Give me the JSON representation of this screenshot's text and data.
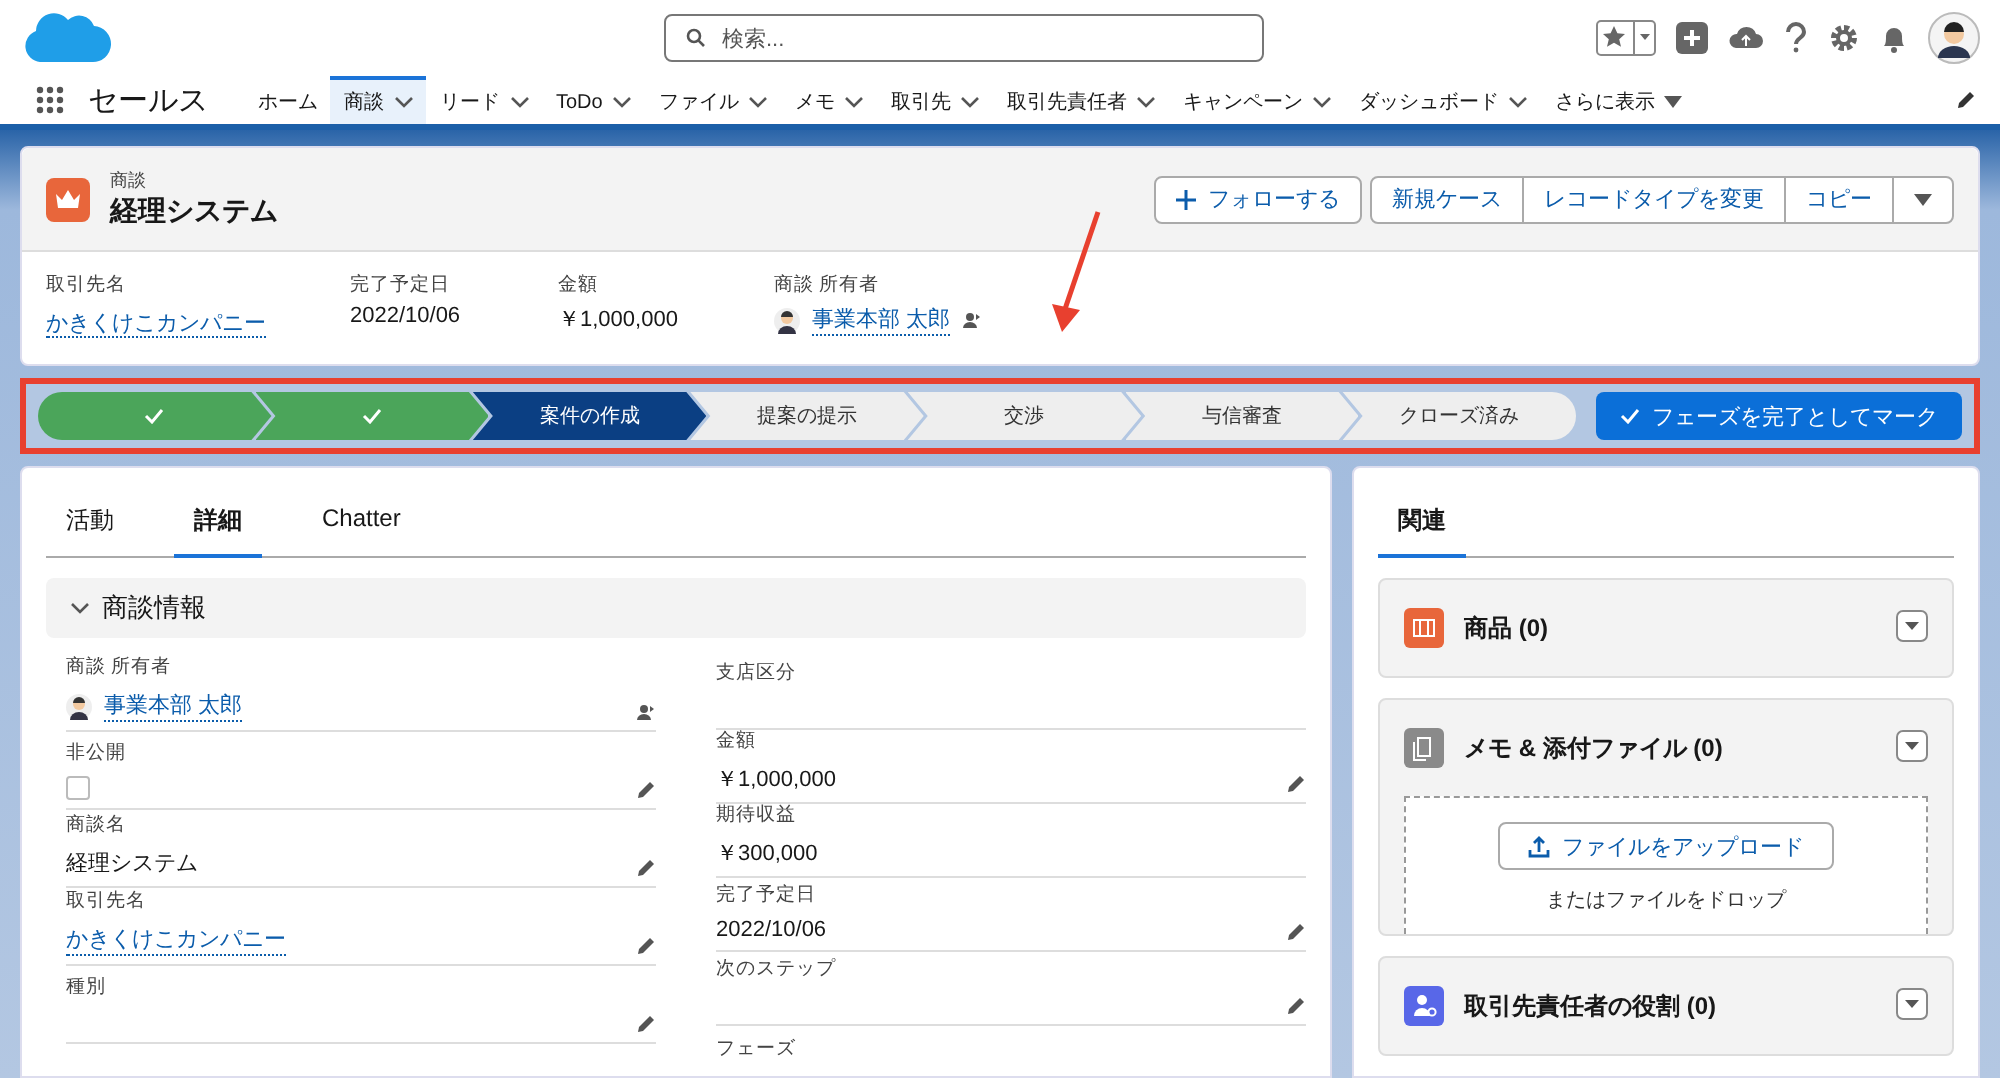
{
  "header": {
    "search": {
      "placeholder": "検索..."
    }
  },
  "nav": {
    "app_name": "セールス",
    "items": [
      {
        "label": "ホーム",
        "kind": "link",
        "selected": false
      },
      {
        "label": "商談",
        "kind": "menu",
        "selected": true
      },
      {
        "label": "リード",
        "kind": "menu",
        "selected": false
      },
      {
        "label": "ToDo",
        "kind": "menu",
        "selected": false
      },
      {
        "label": "ファイル",
        "kind": "menu",
        "selected": false
      },
      {
        "label": "メモ",
        "kind": "menu",
        "selected": false
      },
      {
        "label": "取引先",
        "kind": "menu",
        "selected": false
      },
      {
        "label": "取引先責任者",
        "kind": "menu",
        "selected": false
      },
      {
        "label": "キャンペーン",
        "kind": "menu",
        "selected": false
      },
      {
        "label": "ダッシュボード",
        "kind": "menu",
        "selected": false
      },
      {
        "label": "さらに表示",
        "kind": "more",
        "selected": false
      }
    ]
  },
  "record": {
    "object_label": "商談",
    "title": "経理システム",
    "follow_button": "フォローする",
    "actions": [
      "新規ケース",
      "レコードタイプを変更",
      "コピー"
    ],
    "highlights": [
      {
        "label": "取引先名",
        "value": "かきくけこカンパニー",
        "kind": "link"
      },
      {
        "label": "完了予定日",
        "value": "2022/10/06",
        "kind": "text"
      },
      {
        "label": "金額",
        "value": "￥1,000,000",
        "kind": "text"
      },
      {
        "label": "商談 所有者",
        "value": "事業本部 太郎",
        "kind": "owner"
      }
    ]
  },
  "path": {
    "stages": [
      {
        "completed": true,
        "selected": false
      },
      {
        "completed": true,
        "selected": false
      },
      {
        "label": "案件の作成",
        "completed": false,
        "selected": true
      },
      {
        "label": "提案の提示",
        "completed": false,
        "selected": false
      },
      {
        "label": "交渉",
        "completed": false,
        "selected": false
      },
      {
        "label": "与信審査",
        "completed": false,
        "selected": false
      },
      {
        "label": "クローズ済み",
        "completed": false,
        "selected": false
      }
    ],
    "mark_button": "フェーズを完了としてマーク"
  },
  "detail": {
    "tabs": [
      {
        "label": "活動",
        "selected": false
      },
      {
        "label": "詳細",
        "selected": true
      },
      {
        "label": "Chatter",
        "selected": false
      }
    ],
    "section": {
      "title": "商談情報",
      "expanded": true
    },
    "left_fields": [
      {
        "label": "商談 所有者",
        "kind": "owner",
        "value": "事業本部 太郎",
        "editable": false
      },
      {
        "label": "非公開",
        "kind": "checkbox",
        "checked": false,
        "editable": true
      },
      {
        "label": "商談名",
        "kind": "text",
        "value": "経理システム",
        "editable": true
      },
      {
        "label": "取引先名",
        "kind": "link",
        "value": "かきくけこカンパニー",
        "editable": true
      },
      {
        "label": "種別",
        "kind": "empty",
        "editable": true
      }
    ],
    "right_fields": [
      {
        "label": "支店区分",
        "kind": "empty",
        "editable": false
      },
      {
        "label": "金額",
        "kind": "text",
        "value": "￥1,000,000",
        "editable": true
      },
      {
        "label": "期待収益",
        "kind": "text",
        "value": "￥300,000",
        "editable": false
      },
      {
        "label": "完了予定日",
        "kind": "text",
        "value": "2022/10/06",
        "editable": true
      },
      {
        "label": "次のステップ",
        "kind": "empty",
        "editable": true
      },
      {
        "label": "フェーズ",
        "kind": "cut",
        "editable": false
      }
    ]
  },
  "related": {
    "tab": {
      "label": "関連",
      "selected": true
    },
    "lists": [
      {
        "title": "商品 (0)",
        "kind": "products",
        "color": "#e8663b"
      },
      {
        "title": "メモ & 添付ファイル (0)",
        "kind": "files",
        "color": "#8a8a8a",
        "upload_button": "ファイルをアップロード",
        "drop_hint": "またはファイルをドロップ"
      },
      {
        "title": "取引先責任者の役割 (0)",
        "kind": "contacts",
        "color": "#5867e8"
      }
    ]
  }
}
